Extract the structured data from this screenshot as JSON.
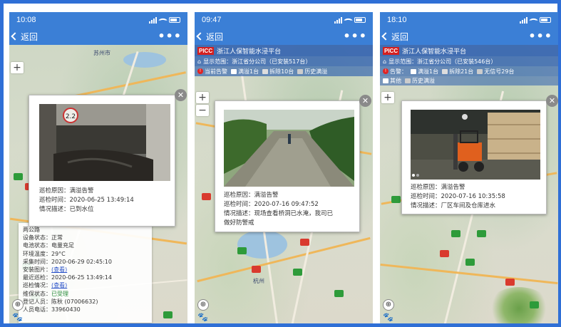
{
  "colors": {
    "frame": "#2f6fd6",
    "header": "#3b7fd6",
    "normal": "#2e9b3a",
    "alarm": "#d93a2e"
  },
  "phones": [
    {
      "status_time": "10:08",
      "nav_back": "返回",
      "nav_more": "•••",
      "map_label": "苏州市",
      "popup": {
        "rows": [
          {
            "label": "巡检原因：",
            "value": "满溢告警"
          },
          {
            "label": "巡检时间：",
            "value": "2020-06-25 13:49:14"
          },
          {
            "label": "情况描述：",
            "value": "已到水位"
          }
        ]
      },
      "info": [
        {
          "label": "设备状态：",
          "value": "正常"
        },
        {
          "label": "电池状态：",
          "value": "电量充足"
        },
        {
          "label": "环境温度：",
          "value": "29°C"
        },
        {
          "label": "采集时间：",
          "value": "2020-06-29 02:45:10"
        },
        {
          "label": "安装图片：",
          "value": "(查看)"
        },
        {
          "label": "最近巡检：",
          "value": "2020-06-25 13:49:14"
        },
        {
          "label": "巡检情况：",
          "value": "(查看)"
        },
        {
          "label": "维保状态：",
          "value": "已受理"
        },
        {
          "label": "登记人员：",
          "value": "陈秋 (07006632)"
        },
        {
          "label": "人员电话：",
          "value": "33960430"
        }
      ],
      "info_top": "两公路"
    },
    {
      "status_time": "09:47",
      "nav_back": "返回",
      "nav_more": "•••",
      "app_title": "浙江人保智能水浸平台",
      "logo": "PICC",
      "range_text": "显示范围：浙江省分公司（已安装517台）",
      "legend": [
        {
          "label": "当前告警",
          "color": "#e02424"
        },
        {
          "label": "满溢1台",
          "color": "#ffffff"
        },
        {
          "label": "拆除10台",
          "color": "#dddddd"
        },
        {
          "label": "历史满溢",
          "color": "#cccccc"
        }
      ],
      "map_label": "杭州",
      "popup": {
        "rows": [
          {
            "label": "巡检原因：",
            "value": "满溢告警"
          },
          {
            "label": "巡检时间：",
            "value": "2020-07-16 09:47:52"
          },
          {
            "label": "情况描述：",
            "value": "现场查看桥洞已水淹，我司已"
          },
          {
            "label": "",
            "value": "做好防警戒"
          }
        ]
      }
    },
    {
      "status_time": "18:10",
      "nav_back": "返回",
      "nav_more": "•••",
      "app_title": "浙江人保智能水浸平台",
      "logo": "PICC",
      "range_text": "显示范围：浙江省分公司（已安装546台）",
      "legend": [
        {
          "label": "告警：",
          "color": "#e02424"
        },
        {
          "label": "满溢1台",
          "color": "#ffffff"
        },
        {
          "label": "拆除21台",
          "color": "#dddddd"
        },
        {
          "label": "无信号29台",
          "color": "#cccccc"
        }
      ],
      "legend2": [
        {
          "label": "其他",
          "color": "#ffffff"
        },
        {
          "label": "历史满溢",
          "color": "#cccccc"
        }
      ],
      "popup": {
        "rows": [
          {
            "label": "巡检原因：",
            "value": "满溢告警"
          },
          {
            "label": "巡检时间：",
            "value": "2020-07-16 10:35:58"
          },
          {
            "label": "情况描述：",
            "value": "厂区车间及仓库进水"
          }
        ]
      }
    }
  ]
}
